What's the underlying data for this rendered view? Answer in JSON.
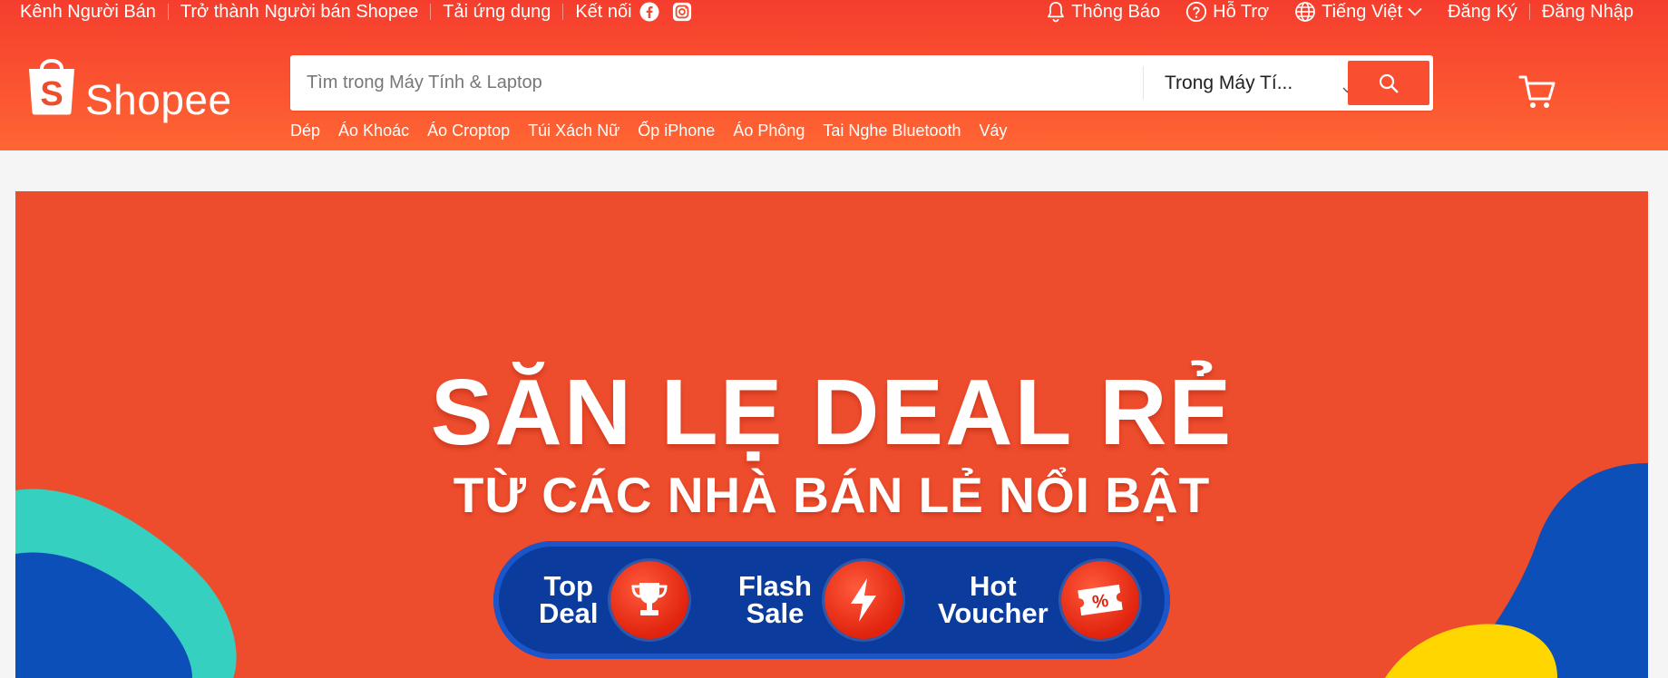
{
  "topbar": {
    "left": [
      "Kênh Người Bán",
      "Trở thành Người bán Shopee",
      "Tải ứng dụng"
    ],
    "connect": "Kết nối",
    "notifications": "Thông Báo",
    "support": "Hỗ Trợ",
    "language": "Tiếng Việt",
    "register": "Đăng Ký",
    "login": "Đăng Nhập"
  },
  "logo": {
    "text": "Shopee"
  },
  "search": {
    "placeholder": "Tìm trong Máy Tính & Laptop",
    "scope": "Trong Máy Tí..."
  },
  "keywords": [
    "Dép",
    "Áo Khoác",
    "Áo Croptop",
    "Túi Xách Nữ",
    "Ốp iPhone",
    "Áo Phông",
    "Tai Nghe Bluetooth",
    "Váy"
  ],
  "banner": {
    "headline": "SĂN LẸ DEAL RẺ",
    "subline": "TỪ CÁC NHÀ BÁN LẺ NỔI BẬT",
    "badges": [
      {
        "line1": "Top",
        "line2": "Deal",
        "icon": "trophy-icon"
      },
      {
        "line1": "Flash",
        "line2": "Sale",
        "icon": "lightning-icon"
      },
      {
        "line1": "Hot",
        "line2": "Voucher",
        "icon": "voucher-icon"
      }
    ]
  },
  "colors": {
    "brand": "#ee4d2d",
    "pill": "#0b3b9c"
  }
}
